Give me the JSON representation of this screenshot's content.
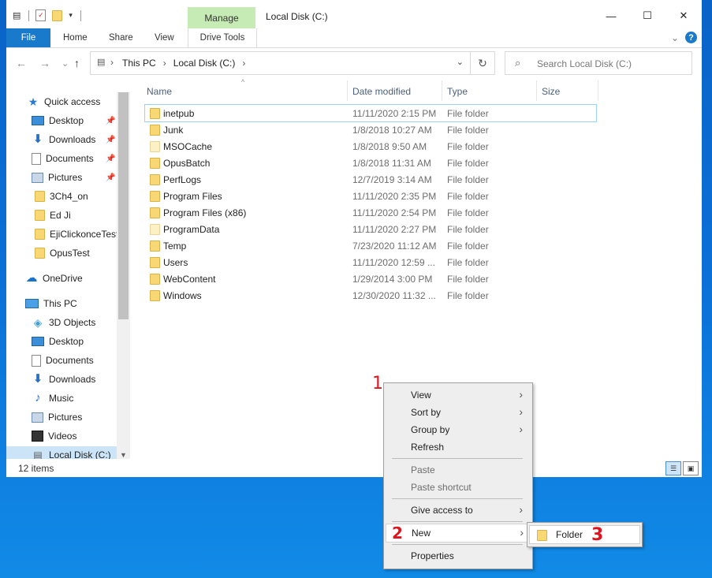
{
  "window": {
    "title": "Local Disk (C:)",
    "contextual_group": "Manage",
    "controls": {
      "minimize": "—",
      "maximize": "☐",
      "close": "✕"
    }
  },
  "ribbon": {
    "tabs": [
      "File",
      "Home",
      "Share",
      "View",
      "Drive Tools"
    ],
    "collapse_glyph": "⌄",
    "help": "?"
  },
  "addressbar": {
    "back": "←",
    "forward": "→",
    "recent": "⌄",
    "up": "↑",
    "crumbs": [
      "This PC",
      "Local Disk (C:)"
    ],
    "separator": "›",
    "dropdown": "⌄",
    "refresh": "↻"
  },
  "search": {
    "icon": "search-icon",
    "placeholder": "Search Local Disk (C:)"
  },
  "navpane": {
    "quick_access": "Quick access",
    "pinned": [
      "Desktop",
      "Downloads",
      "Documents",
      "Pictures"
    ],
    "recent": [
      "3Ch4_on",
      "Ed Ji",
      "EjiClickonceTest",
      "OpusTest"
    ],
    "onedrive": "OneDrive",
    "this_pc": "This PC",
    "pc_items": [
      "3D Objects",
      "Desktop",
      "Documents",
      "Downloads",
      "Music",
      "Pictures",
      "Videos",
      "Local Disk (C:)"
    ]
  },
  "columns": {
    "name": "Name",
    "date": "Date modified",
    "type": "Type",
    "size": "Size"
  },
  "files": [
    {
      "name": "inetpub",
      "date": "11/11/2020 2:15 PM",
      "type": "File folder"
    },
    {
      "name": "Junk",
      "date": "1/8/2018 10:27 AM",
      "type": "File folder"
    },
    {
      "name": "MSOCache",
      "date": "1/8/2018 9:50 AM",
      "type": "File folder"
    },
    {
      "name": "OpusBatch",
      "date": "1/8/2018 11:31 AM",
      "type": "File folder"
    },
    {
      "name": "PerfLogs",
      "date": "12/7/2019 3:14 AM",
      "type": "File folder"
    },
    {
      "name": "Program Files",
      "date": "11/11/2020 2:35 PM",
      "type": "File folder"
    },
    {
      "name": "Program Files (x86)",
      "date": "11/11/2020 2:54 PM",
      "type": "File folder"
    },
    {
      "name": "ProgramData",
      "date": "11/11/2020 2:27 PM",
      "type": "File folder"
    },
    {
      "name": "Temp",
      "date": "7/23/2020 11:12 AM",
      "type": "File folder"
    },
    {
      "name": "Users",
      "date": "11/11/2020 12:59 ...",
      "type": "File folder"
    },
    {
      "name": "WebContent",
      "date": "1/29/2014 3:00 PM",
      "type": "File folder"
    },
    {
      "name": "Windows",
      "date": "12/30/2020 11:32 ...",
      "type": "File folder"
    }
  ],
  "status": {
    "count": "12 items"
  },
  "context_menu": {
    "view": "View",
    "sort_by": "Sort by",
    "group_by": "Group by",
    "refresh": "Refresh",
    "paste": "Paste",
    "paste_shortcut": "Paste shortcut",
    "give_access": "Give access to",
    "new": "New",
    "properties": "Properties",
    "submenu_arrow": "›"
  },
  "submenu": {
    "folder": "Folder"
  },
  "annotations": {
    "one": "1",
    "two": "2",
    "three": "3",
    "color": "#e0141e"
  }
}
